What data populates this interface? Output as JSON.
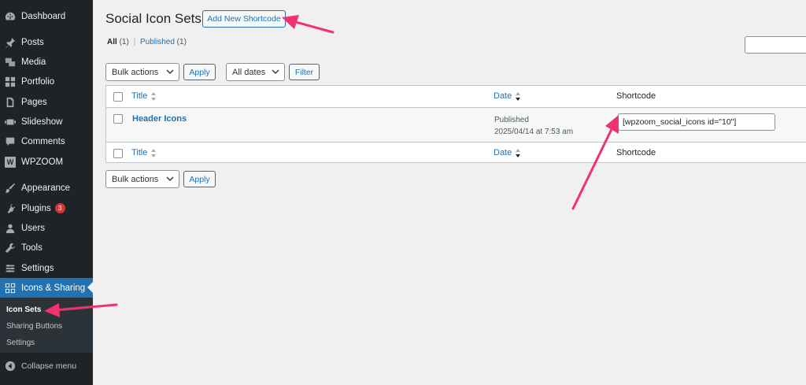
{
  "sidebar": {
    "items": [
      {
        "label": "Dashboard",
        "icon": "dashboard-icon"
      },
      {
        "label": "Posts",
        "icon": "pin-icon"
      },
      {
        "label": "Media",
        "icon": "media-icon"
      },
      {
        "label": "Portfolio",
        "icon": "portfolio-icon"
      },
      {
        "label": "Pages",
        "icon": "pages-icon"
      },
      {
        "label": "Slideshow",
        "icon": "slideshow-icon"
      },
      {
        "label": "Comments",
        "icon": "comment-icon"
      },
      {
        "label": "WPZOOM",
        "icon": "wpzoom-icon",
        "icon_letter": "W"
      },
      {
        "label": "Appearance",
        "icon": "brush-icon"
      },
      {
        "label": "Plugins",
        "icon": "plugin-icon",
        "badge": "3"
      },
      {
        "label": "Users",
        "icon": "user-icon"
      },
      {
        "label": "Tools",
        "icon": "wrench-icon"
      },
      {
        "label": "Settings",
        "icon": "settings-icon"
      },
      {
        "label": "Icons & Sharing",
        "icon": "icons-sharing-icon",
        "active": true
      }
    ],
    "submenu": [
      {
        "label": "Icon Sets",
        "current": true
      },
      {
        "label": "Sharing Buttons"
      },
      {
        "label": "Settings"
      }
    ],
    "collapse_label": "Collapse menu"
  },
  "page": {
    "title": "Social Icon Sets",
    "add_new_label": "Add New Shortcode"
  },
  "filters": {
    "all_label": "All",
    "all_count": "(1)",
    "separator": "|",
    "published_label": "Published",
    "published_count": "(1)"
  },
  "top_actions": {
    "bulk_actions": "Bulk actions",
    "apply": "Apply",
    "all_dates": "All dates",
    "filter": "Filter"
  },
  "table": {
    "columns": {
      "title": "Title",
      "date": "Date",
      "shortcode": "Shortcode"
    },
    "rows": [
      {
        "title": "Header Icons",
        "status": "Published",
        "date": "2025/04/14 at 7:53 am",
        "shortcode": "[wpzoom_social_icons id=\"10\"]"
      }
    ]
  },
  "bottom_actions": {
    "bulk_actions": "Bulk actions",
    "apply": "Apply"
  },
  "colors": {
    "sidebar_bg": "#1d2327",
    "accent": "#2271b1",
    "annotation_arrow": "#f0326e",
    "badge": "#d63638"
  }
}
